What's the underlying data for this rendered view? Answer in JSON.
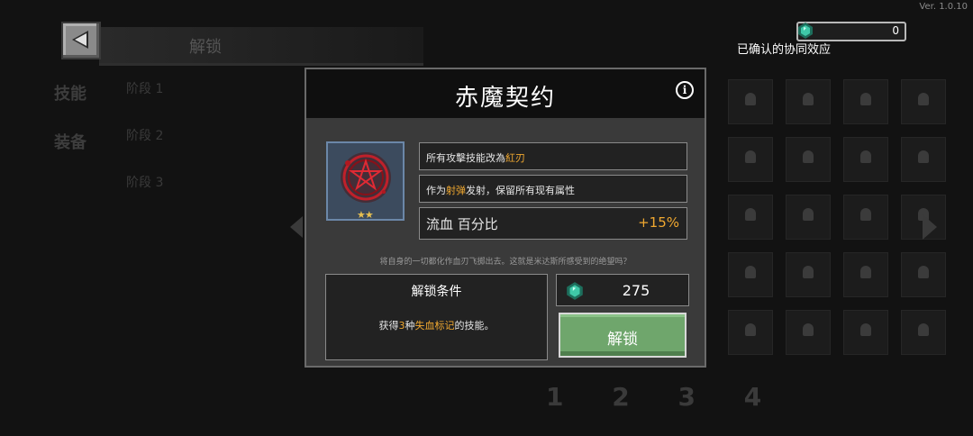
{
  "header": {
    "version": "Ver. 1.0.10",
    "confirmed_count": "0",
    "synergy_label": "已确认的协同效应"
  },
  "background": {
    "section_title": "解锁",
    "side_tabs": [
      "技能",
      "装备"
    ],
    "list_items": [
      "阶段 1",
      "阶段 2",
      "阶段 3"
    ],
    "pages": "1 2 3 4"
  },
  "modal": {
    "title": "赤魔契约",
    "item_stars": "★★",
    "traits": [
      {
        "prefix": "所有攻擊技能改為",
        "highlight": "紅刃",
        "suffix": ""
      },
      {
        "prefix": "作为",
        "highlight": "射弹",
        "suffix": "发射，保留所有现有属性"
      }
    ],
    "stat": {
      "label": "流血 百分比",
      "value": "+15%"
    },
    "flavor": "将自身的一切都化作血刃飞掷出去。这就是米达斯所感受到的绝望吗？",
    "unlock_condition": {
      "heading": "解锁条件",
      "prefix": "获得",
      "count": "3",
      "middle": "种",
      "highlight": "失血标记",
      "suffix": "的技能。"
    },
    "cost": "275",
    "unlock_button": "解锁"
  },
  "colors": {
    "accent": "#f0a830",
    "button_green": "#6fa66c",
    "gem_teal": "#3fc8a8"
  }
}
